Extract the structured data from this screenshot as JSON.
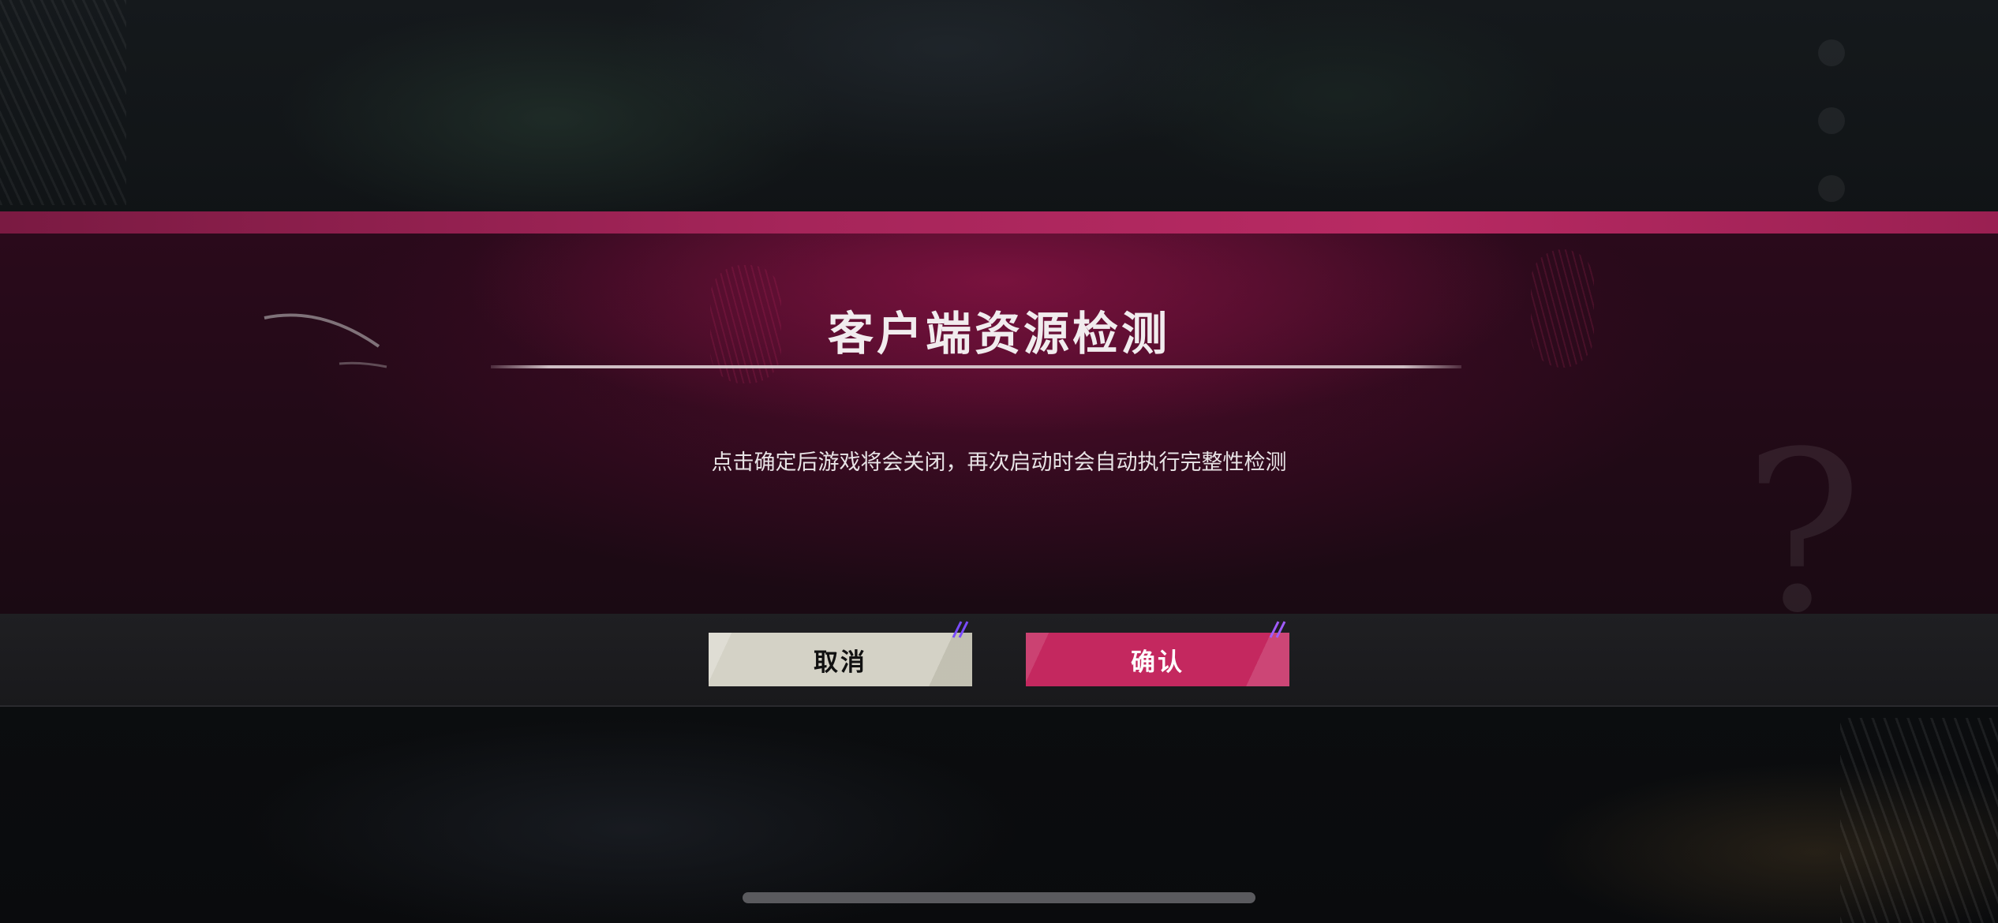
{
  "dialog": {
    "title": "客户端资源检测",
    "message": "点击确定后游戏将会关闭，再次启动时会自动执行完整性检测",
    "cancel_label": "取消",
    "confirm_label": "确认"
  },
  "colors": {
    "accent": "#b82a63",
    "confirm_button": "#c4285f",
    "cancel_button": "#d4d2c6"
  }
}
